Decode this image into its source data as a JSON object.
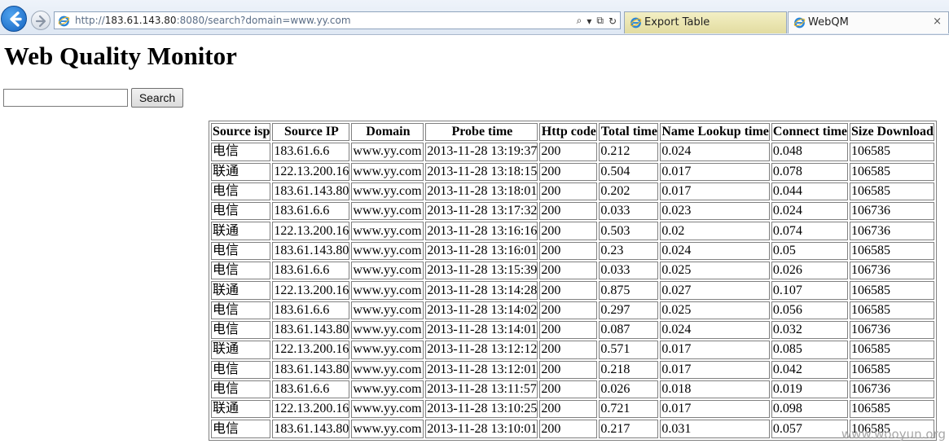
{
  "browser": {
    "url_prefix": "http://",
    "url_host": "183.61.143.80",
    "url_rest": ":8080/search?domain=www.yy.com",
    "search_glyph": "⌕",
    "dropdown_glyph": "▾",
    "compat_glyph": "⧉",
    "refresh_glyph": "↻",
    "tabs": [
      {
        "label": "Export Table"
      },
      {
        "label": "WebQM"
      }
    ],
    "close_glyph": "×"
  },
  "page": {
    "title": "Web Quality Monitor",
    "search_value": "",
    "search_button_label": "Search",
    "watermark": "www.wooyun.org"
  },
  "table": {
    "headers": [
      "Source isp",
      "Source IP",
      "Domain",
      "Probe time",
      "Http code",
      "Total time",
      "Name Lookup time",
      "Connect time",
      "Size Download"
    ],
    "rows": [
      [
        "电信",
        "183.61.6.6",
        "www.yy.com",
        "2013-11-28 13:19:37",
        "200",
        "0.212",
        "0.024",
        "0.048",
        "106585"
      ],
      [
        "联通",
        "122.13.200.16",
        "www.yy.com",
        "2013-11-28 13:18:15",
        "200",
        "0.504",
        "0.017",
        "0.078",
        "106585"
      ],
      [
        "电信",
        "183.61.143.80",
        "www.yy.com",
        "2013-11-28 13:18:01",
        "200",
        "0.202",
        "0.017",
        "0.044",
        "106585"
      ],
      [
        "电信",
        "183.61.6.6",
        "www.yy.com",
        "2013-11-28 13:17:32",
        "200",
        "0.033",
        "0.023",
        "0.024",
        "106736"
      ],
      [
        "联通",
        "122.13.200.16",
        "www.yy.com",
        "2013-11-28 13:16:16",
        "200",
        "0.503",
        "0.02",
        "0.074",
        "106736"
      ],
      [
        "电信",
        "183.61.143.80",
        "www.yy.com",
        "2013-11-28 13:16:01",
        "200",
        "0.23",
        "0.024",
        "0.05",
        "106585"
      ],
      [
        "电信",
        "183.61.6.6",
        "www.yy.com",
        "2013-11-28 13:15:39",
        "200",
        "0.033",
        "0.025",
        "0.026",
        "106736"
      ],
      [
        "联通",
        "122.13.200.16",
        "www.yy.com",
        "2013-11-28 13:14:28",
        "200",
        "0.875",
        "0.027",
        "0.107",
        "106585"
      ],
      [
        "电信",
        "183.61.6.6",
        "www.yy.com",
        "2013-11-28 13:14:02",
        "200",
        "0.297",
        "0.025",
        "0.056",
        "106585"
      ],
      [
        "电信",
        "183.61.143.80",
        "www.yy.com",
        "2013-11-28 13:14:01",
        "200",
        "0.087",
        "0.024",
        "0.032",
        "106736"
      ],
      [
        "联通",
        "122.13.200.16",
        "www.yy.com",
        "2013-11-28 13:12:12",
        "200",
        "0.571",
        "0.017",
        "0.085",
        "106585"
      ],
      [
        "电信",
        "183.61.143.80",
        "www.yy.com",
        "2013-11-28 13:12:01",
        "200",
        "0.218",
        "0.017",
        "0.042",
        "106585"
      ],
      [
        "电信",
        "183.61.6.6",
        "www.yy.com",
        "2013-11-28 13:11:57",
        "200",
        "0.026",
        "0.018",
        "0.019",
        "106736"
      ],
      [
        "联通",
        "122.13.200.16",
        "www.yy.com",
        "2013-11-28 13:10:25",
        "200",
        "0.721",
        "0.017",
        "0.098",
        "106585"
      ],
      [
        "电信",
        "183.61.143.80",
        "www.yy.com",
        "2013-11-28 13:10:01",
        "200",
        "0.217",
        "0.031",
        "0.057",
        "106585"
      ]
    ]
  }
}
